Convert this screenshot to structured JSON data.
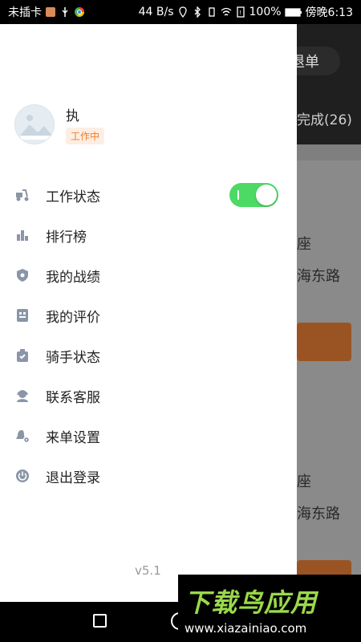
{
  "status_bar": {
    "carrier": "未插卡",
    "speed": "44 B/s",
    "battery": "100%",
    "time": "傍晚6:13"
  },
  "background_app": {
    "top_button": "退单",
    "tab": "完成(26)",
    "card1_line1": "座",
    "card1_line2": "海东路",
    "card2_line1": "座",
    "card2_line2": "海东路"
  },
  "drawer": {
    "user": {
      "name": "执",
      "status": "工作中"
    },
    "menu": [
      {
        "label": "工作状态",
        "icon": "scooter-icon",
        "toggle": true
      },
      {
        "label": "排行榜",
        "icon": "bar-chart-icon"
      },
      {
        "label": "我的战绩",
        "icon": "shield-star-icon"
      },
      {
        "label": "我的评价",
        "icon": "rating-icon"
      },
      {
        "label": "骑手状态",
        "icon": "rider-status-icon"
      },
      {
        "label": "联系客服",
        "icon": "headset-icon"
      },
      {
        "label": "来单设置",
        "icon": "bell-settings-icon"
      },
      {
        "label": "退出登录",
        "icon": "power-icon"
      }
    ],
    "version": "v5.1"
  },
  "watermark": {
    "brand": "下载鸟应用",
    "url": "www.xiazainiao.com"
  },
  "colors": {
    "toggle_on": "#4cd964",
    "badge_text": "#f07c2a",
    "badge_bg": "#fdeee3",
    "icon_gray": "#8a95a8"
  }
}
